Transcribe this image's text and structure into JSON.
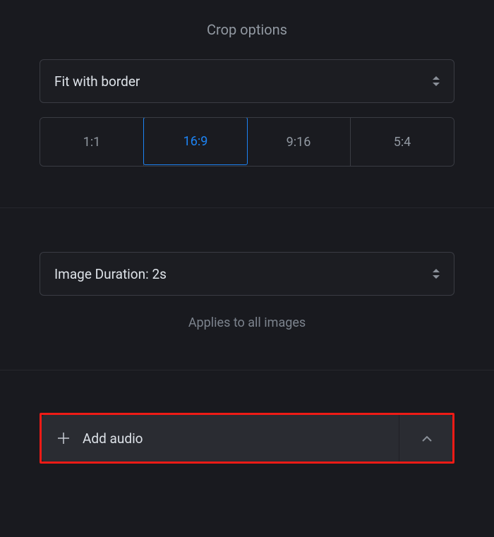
{
  "crop": {
    "title": "Crop options",
    "fit_mode": "Fit with border",
    "ratios": [
      "1:1",
      "16:9",
      "9:16",
      "5:4"
    ],
    "selected_ratio_index": 1
  },
  "duration": {
    "label": "Image Duration: 2s",
    "helper": "Applies to all images"
  },
  "audio": {
    "add_label": "Add audio"
  }
}
